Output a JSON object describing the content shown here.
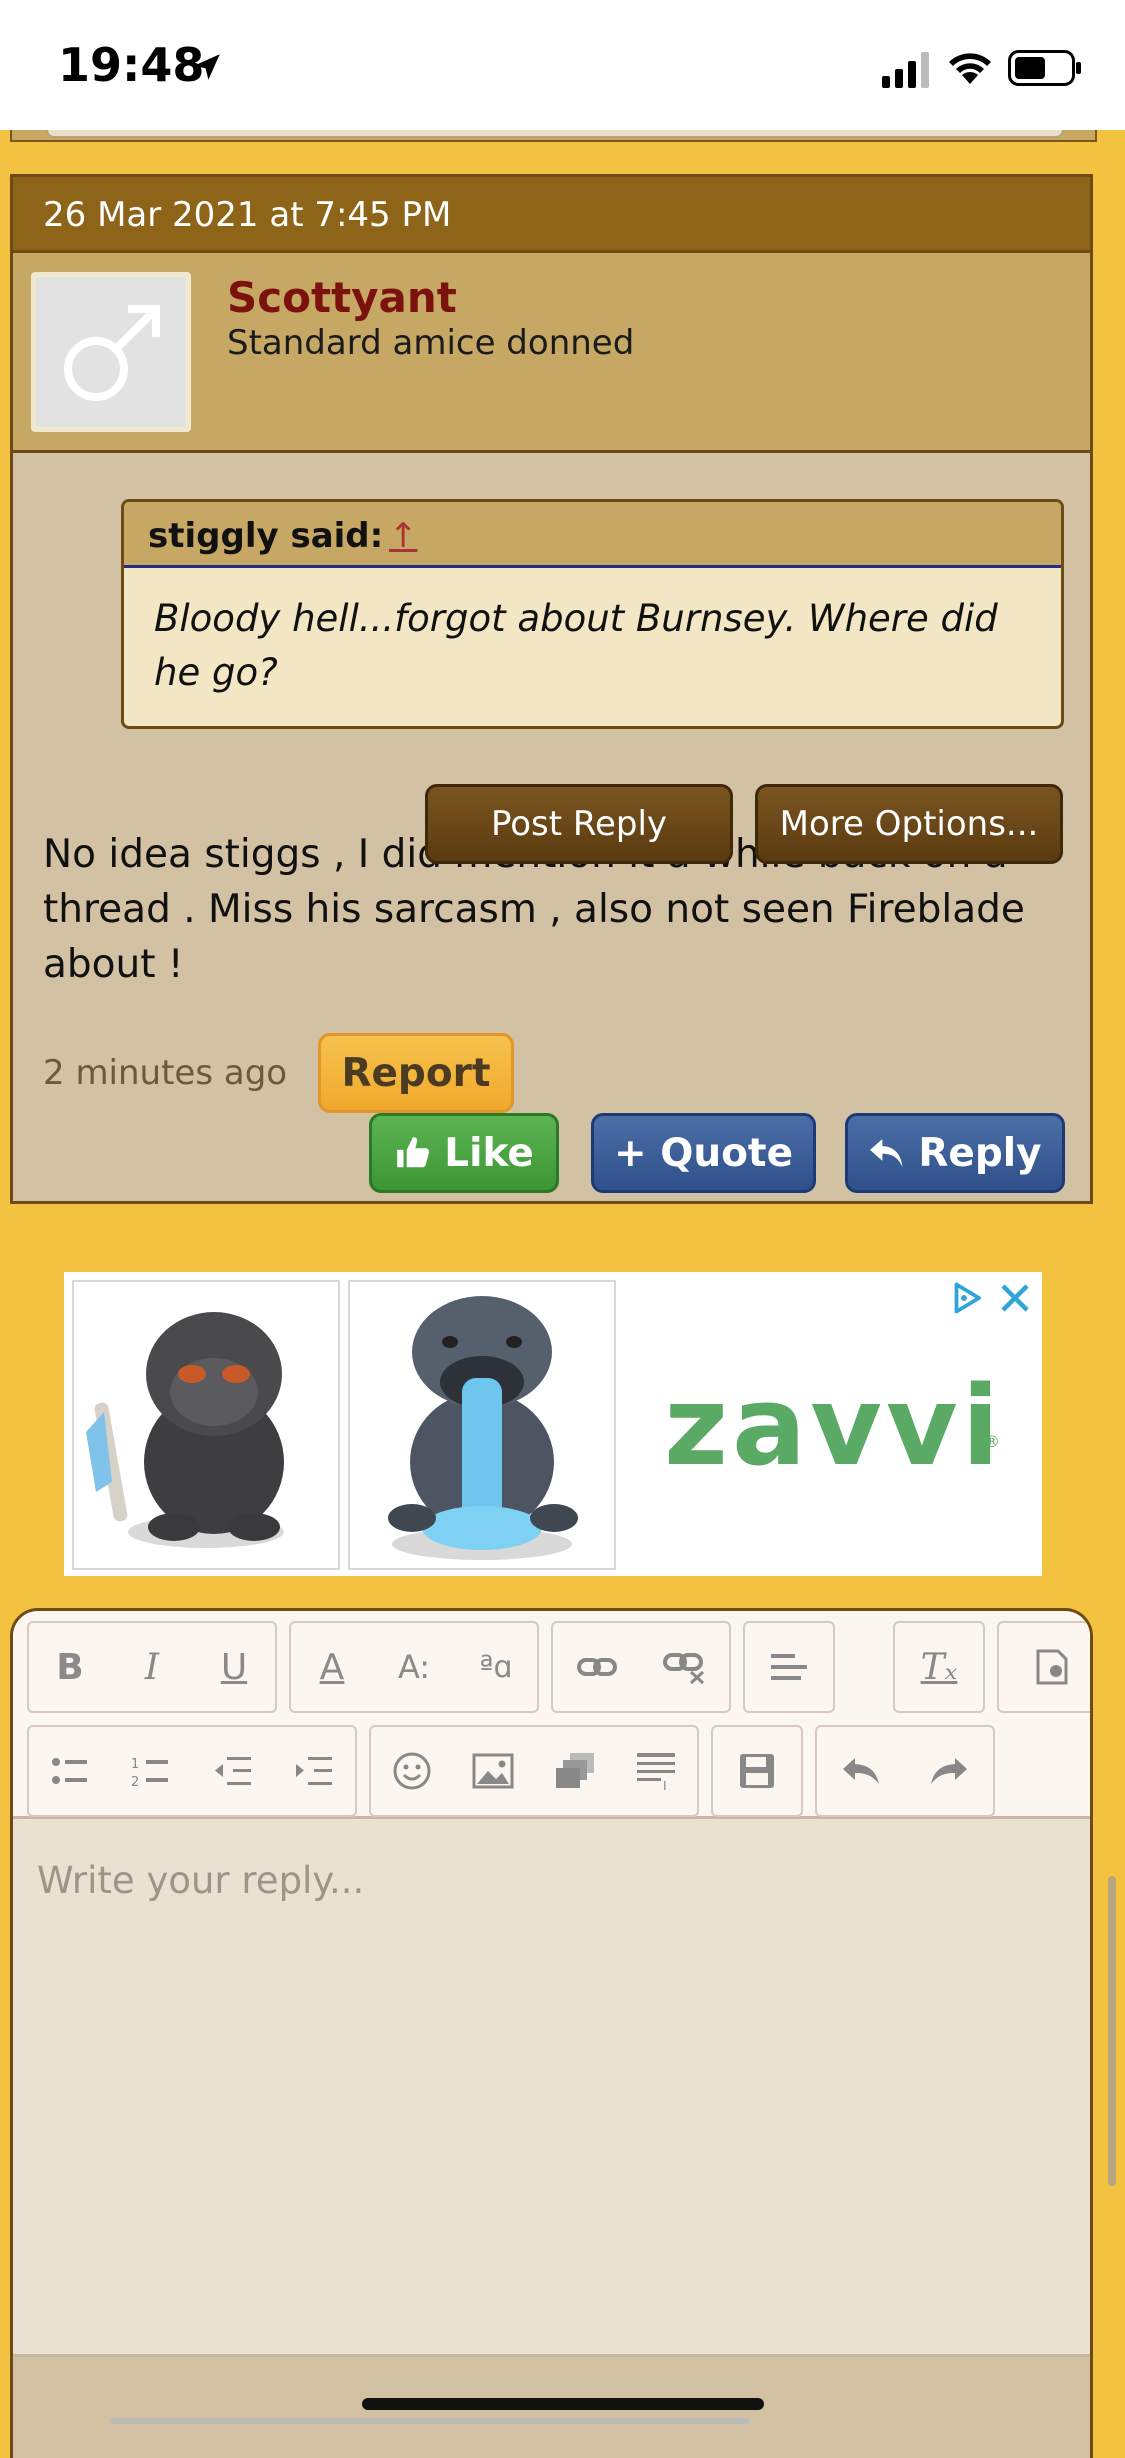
{
  "status_bar": {
    "time": "19:48"
  },
  "post": {
    "date": "26 Mar 2021 at 7:45 PM",
    "username": "Scottyant",
    "user_title": "Standard amice donned",
    "quote": {
      "author": "stiggly said:",
      "link": "↑",
      "text": "Bloody hell...forgot about Burnsey. Where did he go?"
    },
    "body": "No idea stiggs , I did mention it a while back on a thread . Miss his sarcasm , also not seen Fireblade about !",
    "time_ago": "2 minutes ago",
    "buttons": {
      "report": "Report",
      "like": "Like",
      "quote": "+ Quote",
      "reply": "Reply"
    }
  },
  "ad": {
    "brand": "zavvi"
  },
  "editor": {
    "placeholder": "Write your reply...",
    "post_reply": "Post Reply",
    "more_options": "More Options..."
  }
}
